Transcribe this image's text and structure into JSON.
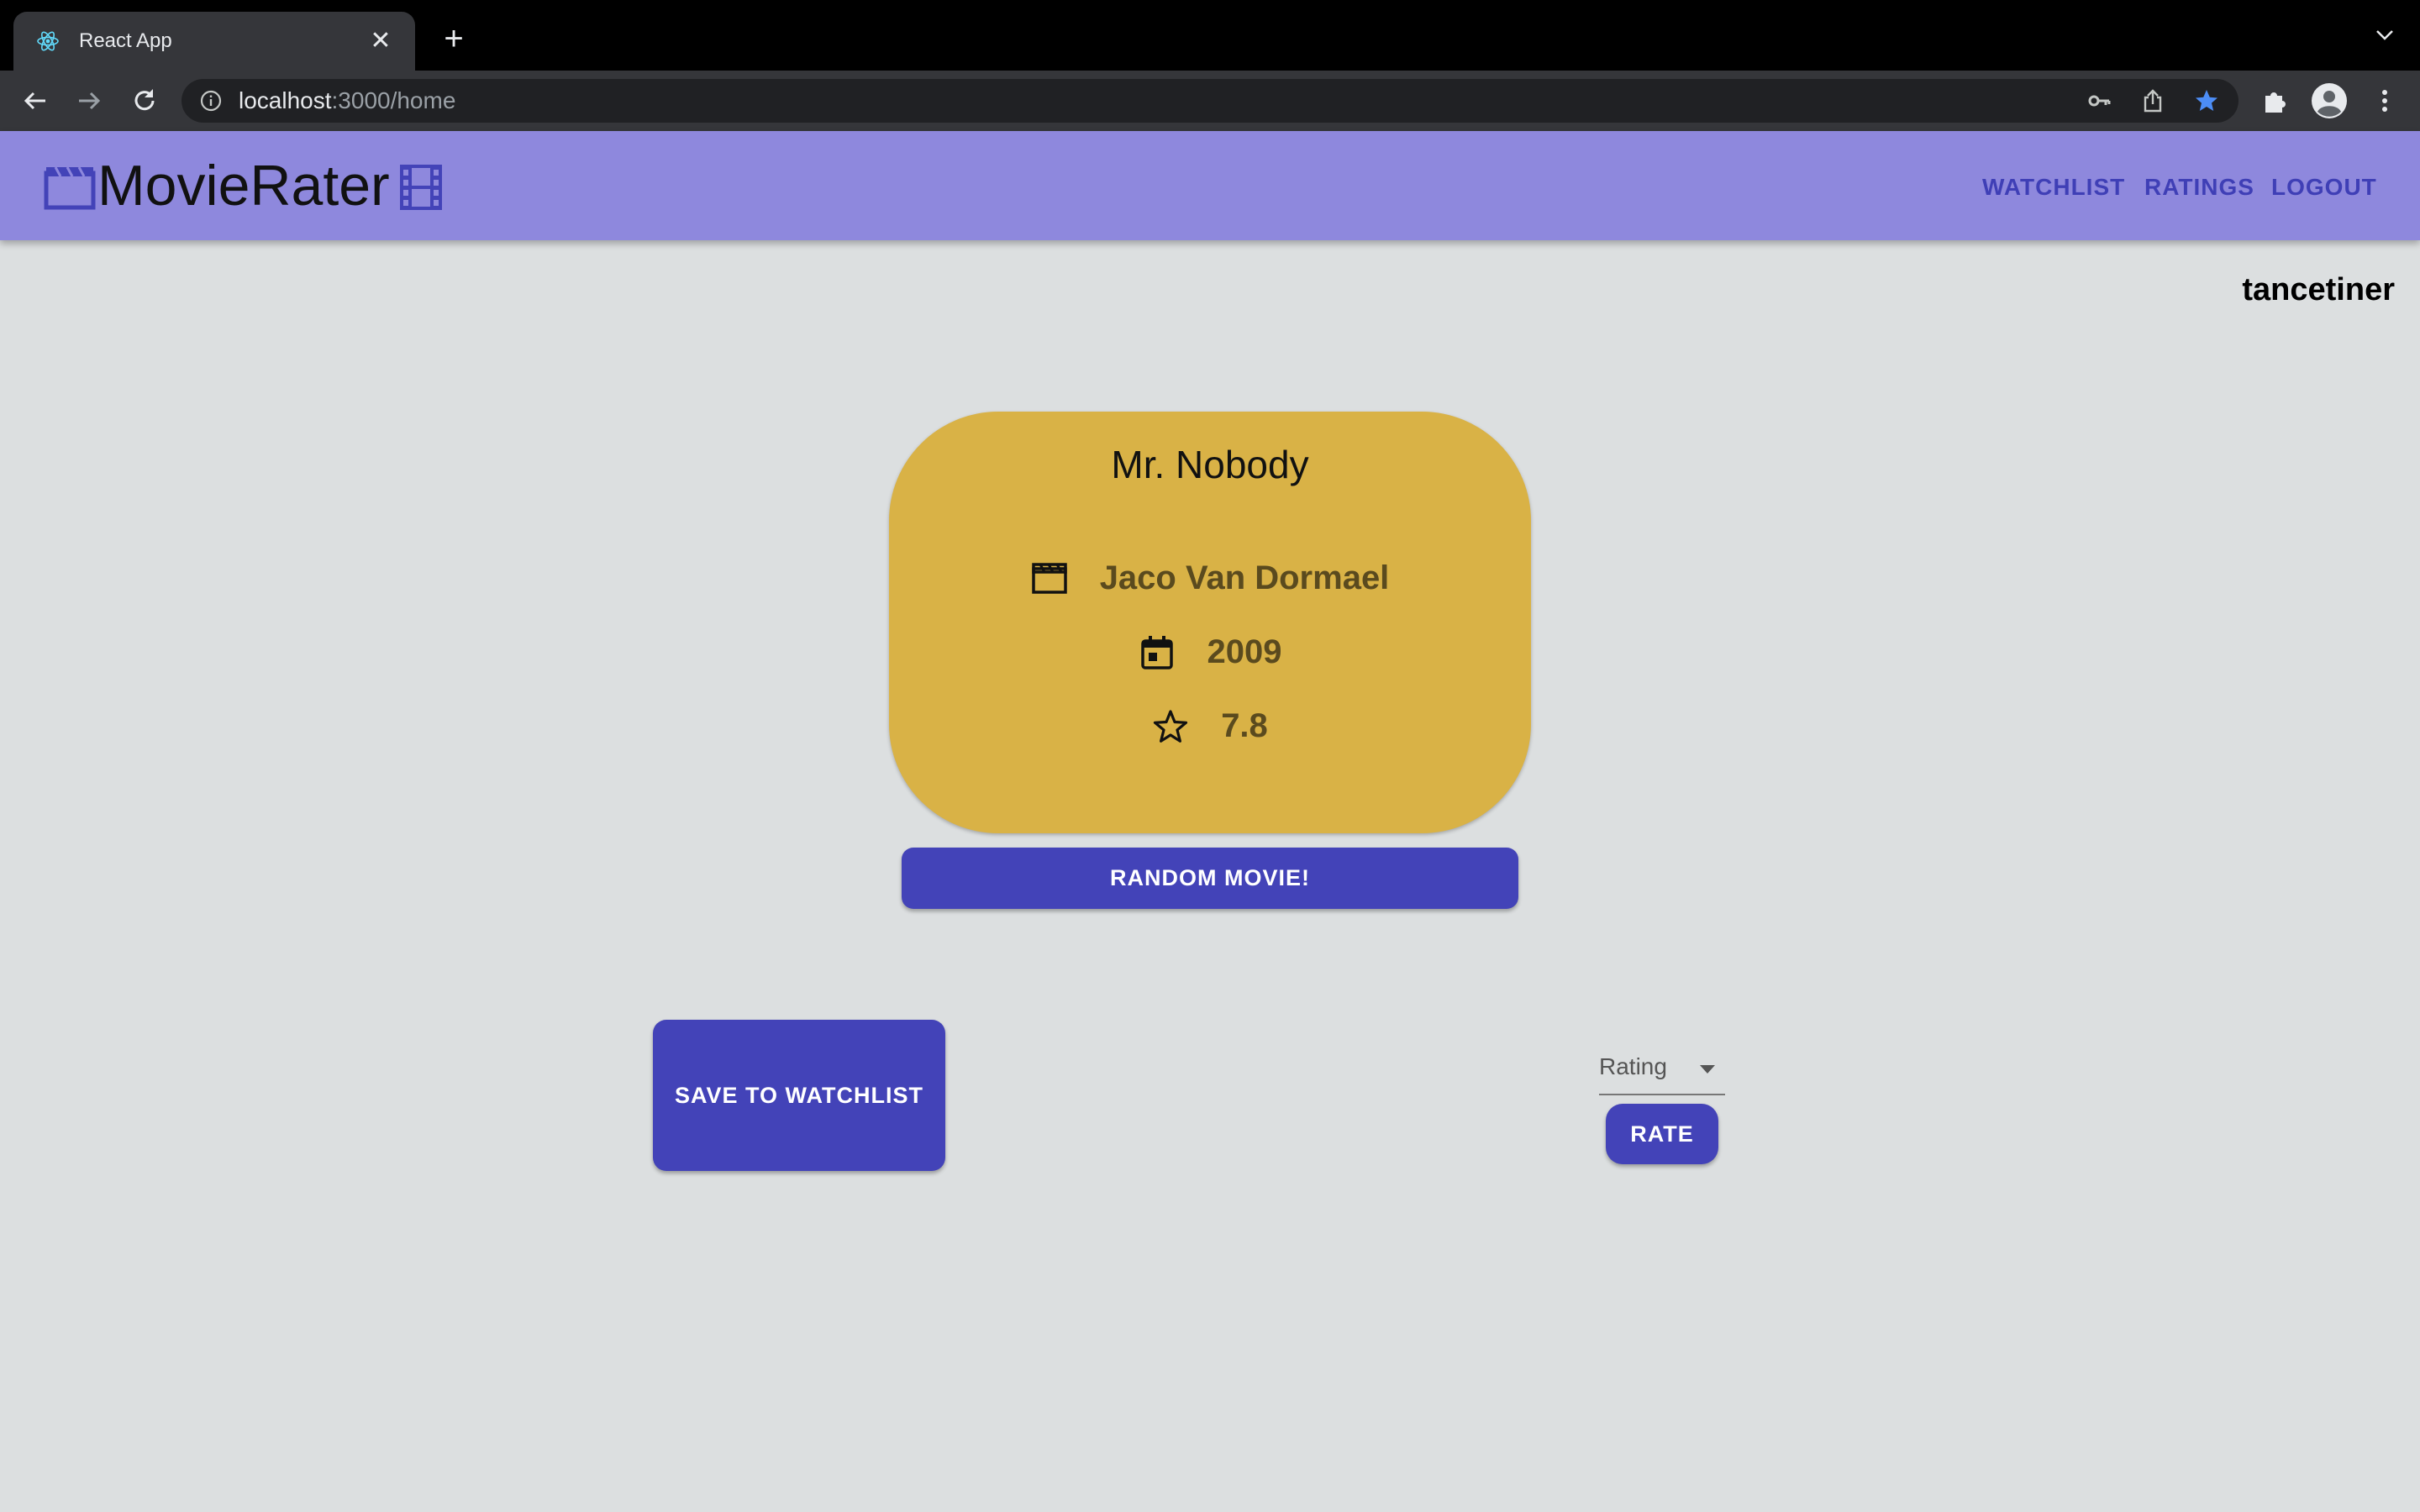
{
  "browser": {
    "tab_title": "React App",
    "url_host": "localhost",
    "url_rest": ":3000/home"
  },
  "app": {
    "brand": "MovieRater",
    "nav": [
      "WATCHLIST",
      "RATINGS",
      "LOGOUT"
    ],
    "username": "tancetiner"
  },
  "movie": {
    "title": "Mr. Nobody",
    "director": "Jaco Van Dormael",
    "year": "2009",
    "rating": "7.8"
  },
  "actions": {
    "random_label": "RANDOM MOVIE!",
    "save_label": "SAVE TO WATCHLIST",
    "rating_placeholder": "Rating",
    "rate_label": "RATE"
  },
  "colors": {
    "appbar": "#8e88dd",
    "accent": "#4343b8",
    "card": "#d9b246",
    "background": "#dcdfe0"
  },
  "icons": {
    "director": "movie-clapper-icon",
    "year": "calendar-icon",
    "rating": "star-outline-icon"
  }
}
